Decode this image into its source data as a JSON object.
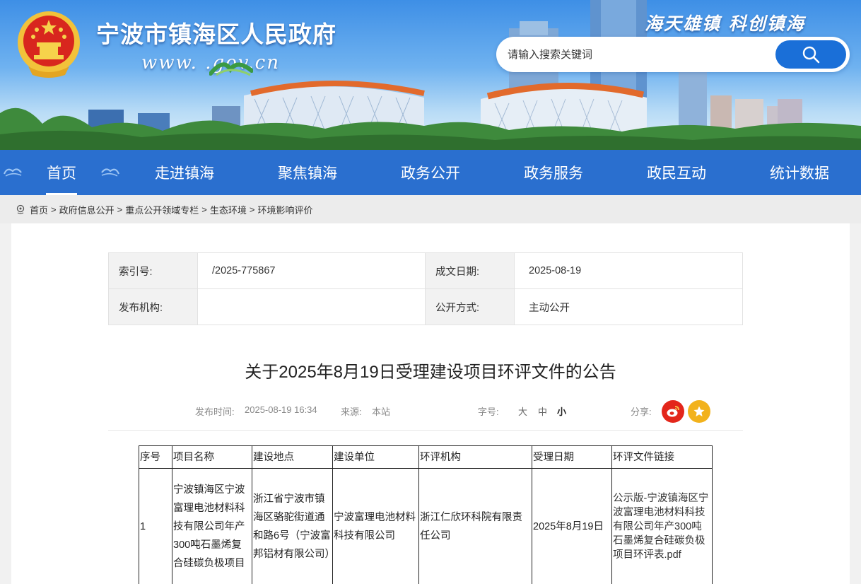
{
  "header": {
    "site_title": "宁波市镇海区人民政府",
    "site_domain": "www.  .gov.cn",
    "slogan": "海天雄镇  科创镇海",
    "search_placeholder": "请输入搜索关键词",
    "search_icon": "search-icon"
  },
  "nav": {
    "items": [
      {
        "label": "首页",
        "active": true
      },
      {
        "label": "走进镇海"
      },
      {
        "label": "聚焦镇海"
      },
      {
        "label": "政务公开"
      },
      {
        "label": "政务服务"
      },
      {
        "label": "政民互动"
      },
      {
        "label": "统计数据"
      }
    ],
    "color": "#2a6fcf"
  },
  "breadcrumb": [
    "首页",
    "政府信息公开",
    "重点公开领域专栏",
    "生态环境",
    "环境影响评价"
  ],
  "breadcrumb_sep": ">",
  "meta": {
    "index_label": "索引号:",
    "index_value": "/2025-775867",
    "date_label": "成文日期:",
    "date_value": "2025-08-19",
    "org_label": "发布机构:",
    "org_value": "",
    "mode_label": "公开方式:",
    "mode_value": "主动公开"
  },
  "article": {
    "title": "关于2025年8月19日受理建设项目环评文件的公告",
    "publish_label": "发布时间:",
    "publish_time": "2025-08-19 16:34",
    "source_label": "来源:",
    "source_value": "本站",
    "font_label": "字号:",
    "font_large": "大",
    "font_medium": "中",
    "font_small": "小",
    "share_label": "分享:"
  },
  "table": {
    "headers": [
      "序号",
      "项目名称",
      "建设地点",
      "建设单位",
      "环评机构",
      "受理日期",
      "环评文件链接"
    ],
    "rows": [
      {
        "no": "1",
        "name": "宁波镇海区宁波富理电池材料科技有限公司年产300吨石墨烯复合硅碳负极项目",
        "location": "浙江省宁波市镇海区骆驼街道通和路6号（宁波富邦铝材有限公司）",
        "builder": "宁波富理电池材料科技有限公司",
        "agency": "浙江仁欣环科院有限责任公司",
        "date": "2025年8月19日",
        "link": "公示版-宁波镇海区宁波富理电池材料科技有限公司年产300吨石墨烯复合硅碳负极项目环评表.pdf"
      }
    ]
  },
  "colors": {
    "nav_blue": "#2a6fcf",
    "search_blue": "#1a6fd8",
    "weibo_red": "#e3261b",
    "fav_yellow": "#f2b21c"
  }
}
